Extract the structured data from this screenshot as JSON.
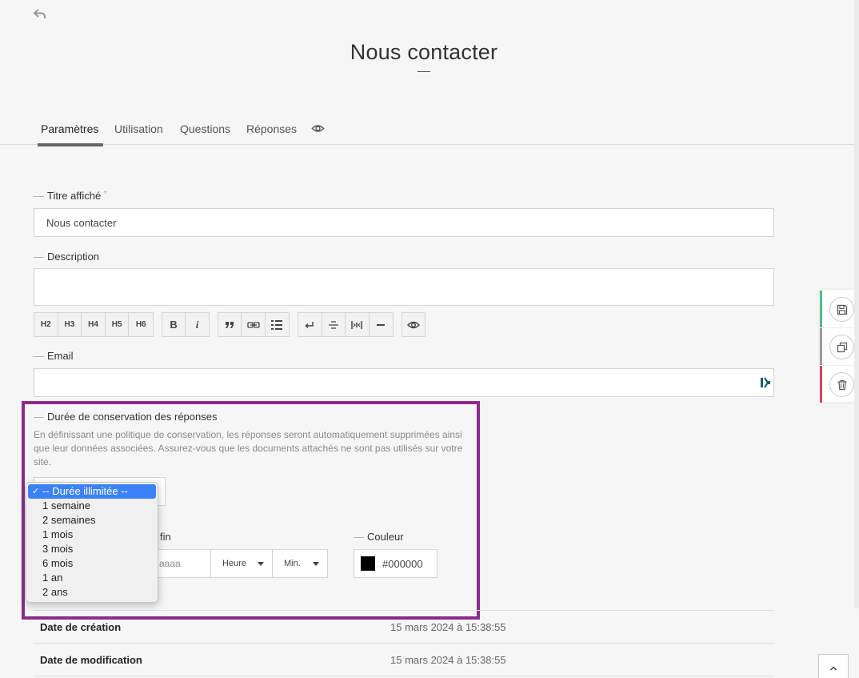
{
  "page": {
    "title": "Nous contacter"
  },
  "tabs": [
    {
      "label": "Paramètres",
      "active": true
    },
    {
      "label": "Utilisation"
    },
    {
      "label": "Questions"
    },
    {
      "label": "Réponses"
    }
  ],
  "fields": {
    "title_label": "Titre affiché",
    "title_required_mark": "*",
    "title_value": "Nous contacter",
    "description_label": "Description",
    "email_label": "Email",
    "retention_label": "Durée de conservation des réponses",
    "retention_help": "En définissant une politique de conservation, les réponses seront automatiquement supprimées ainsi que leur données associées. Assurez-vous que les documents attachés ne sont pas utilisés sur votre site.",
    "end_date_label_fragment": "fin",
    "end_date_placeholder_fragment": "aaaa",
    "hour_label": "Heure",
    "minute_label": "Min.",
    "color_label": "Couleur",
    "color_value": "#000000"
  },
  "editor_toolbar": {
    "headings": [
      "H2",
      "H3",
      "H4",
      "H5",
      "H6"
    ],
    "format_icons": [
      "bold-icon",
      "italic-icon"
    ],
    "block_icons": [
      "quote-icon",
      "link-icon",
      "list-icon"
    ],
    "misc_icons": [
      "line-break-icon",
      "strikethrough-icon",
      "spacing-icon",
      "horizontal-rule-icon"
    ],
    "preview_icon": "eye-icon",
    "bold_label": "B",
    "italic_label": "i"
  },
  "retention_dropdown": {
    "check_mark": "✓",
    "options": [
      "-- Durée illimitée --",
      "1 semaine",
      "2 semaines",
      "1 mois",
      "3 mois",
      "6 mois",
      "1 an",
      "2 ans"
    ],
    "selected_index": 0
  },
  "info_table": [
    {
      "key": "Date de création",
      "value": "15 mars 2024 à 15:38:55"
    },
    {
      "key": "Date de modification",
      "value": "15 mars 2024 à 15:38:55"
    }
  ],
  "side_actions": [
    {
      "icon": "save-icon",
      "color": "#4ec08e"
    },
    {
      "icon": "duplicate-icon",
      "color": "#999999"
    },
    {
      "icon": "trash-icon",
      "color": "#d6455d"
    }
  ],
  "colors": {
    "highlight_border": "#8b2c8c",
    "dropdown_selected": "#3b82f6",
    "swatch": "#000000"
  }
}
